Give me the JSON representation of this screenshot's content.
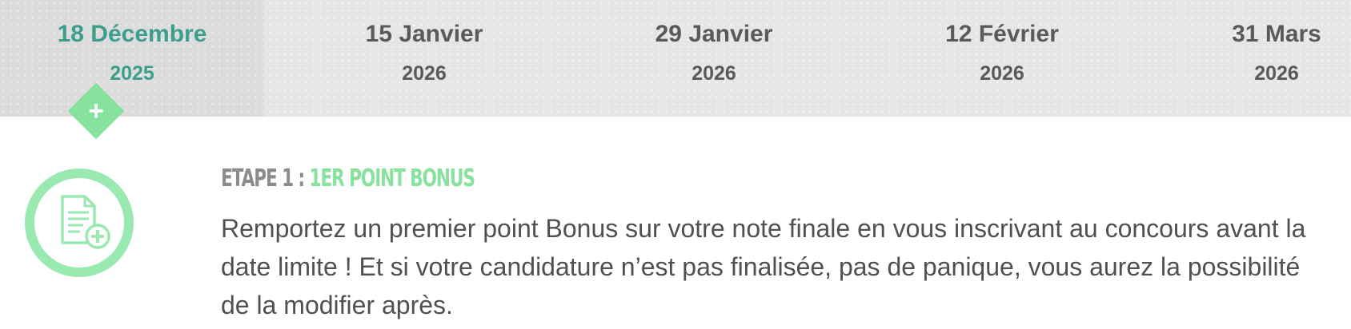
{
  "timeline": {
    "dates": [
      {
        "day": "18 Décembre",
        "year": "2025",
        "active": true
      },
      {
        "day": "15 Janvier",
        "year": "2026",
        "active": false
      },
      {
        "day": "29 Janvier",
        "year": "2026",
        "active": false
      },
      {
        "day": "12 Février",
        "year": "2026",
        "active": false
      },
      {
        "day": "31 Mars",
        "year": "2026",
        "active": false
      }
    ],
    "marker_icon": "plus-icon"
  },
  "step": {
    "prefix": "ETAPE 1 : ",
    "name": "1ER POINT BONUS",
    "icon": "document-plus-icon",
    "description": "Remportez un premier point Bonus sur votre note finale en vous inscrivant au concours avant la date limite ! Et si votre candidature n’est pas finalisée, pas de panique, vous aurez la possibilité de la modifier après."
  },
  "colors": {
    "active_teal": "#3e9e8c",
    "accent_green": "#86e29c",
    "inactive_gray": "#5a5a5a",
    "body_text": "#505050"
  }
}
